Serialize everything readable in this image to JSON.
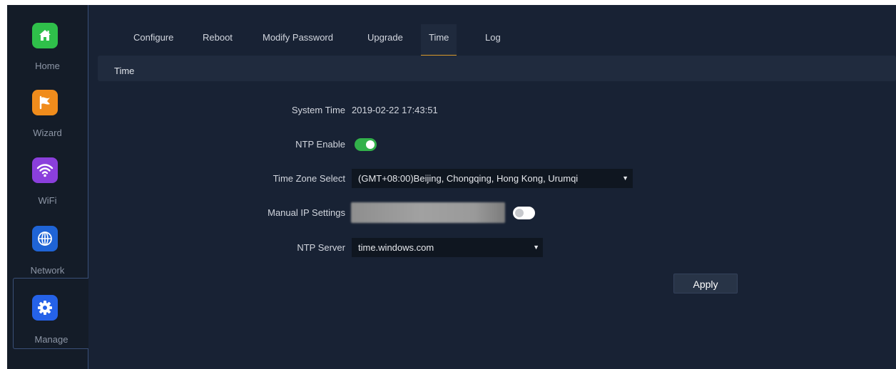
{
  "sidebar": {
    "items": [
      {
        "label": "Home",
        "icon": "home-icon",
        "color": "#2fbf4a"
      },
      {
        "label": "Wizard",
        "icon": "flag-icon",
        "color": "#f08c1c"
      },
      {
        "label": "WiFi",
        "icon": "wifi-icon",
        "color": "#8b3fdc"
      },
      {
        "label": "Network",
        "icon": "globe-icon",
        "color": "#1f64d6"
      },
      {
        "label": "Manage",
        "icon": "gear-icon",
        "color": "#2562e8",
        "active": true
      }
    ]
  },
  "tabs": [
    {
      "label": "Configure"
    },
    {
      "label": "Reboot"
    },
    {
      "label": "Modify Password"
    },
    {
      "label": "Upgrade"
    },
    {
      "label": "Time",
      "active": true
    },
    {
      "label": "Log"
    }
  ],
  "section": {
    "title": "Time"
  },
  "form": {
    "system_time_label": "System Time",
    "system_time_value": "2019-02-22 17:43:51",
    "ntp_enable_label": "NTP Enable",
    "ntp_enable": true,
    "time_zone_label": "Time Zone Select",
    "time_zone_value": "(GMT+08:00)Beijing, Chongqing, Hong Kong, Urumqi",
    "manual_ip_label": "Manual IP Settings",
    "manual_ip_enabled": false,
    "ntp_server_label": "NTP Server",
    "ntp_server_value": "time.windows.com",
    "apply_label": "Apply"
  },
  "colors": {
    "accent_tab": "#d99a2a",
    "toggle_on": "#32b14a"
  }
}
